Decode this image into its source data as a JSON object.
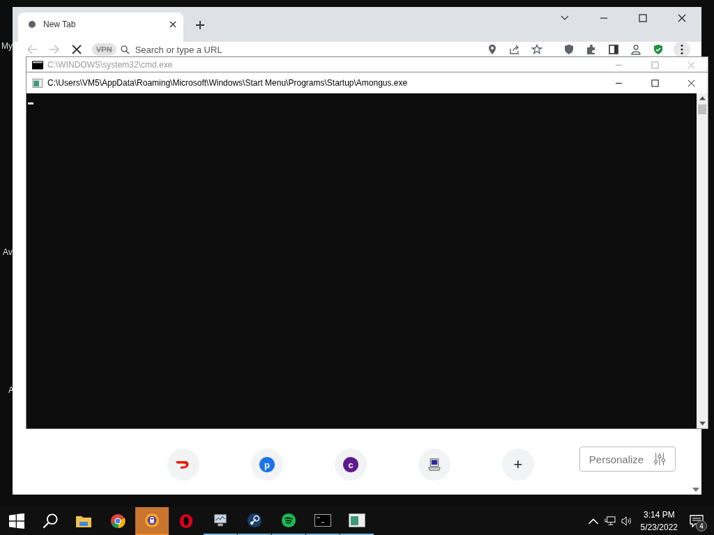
{
  "desktop": {
    "icon_labels": [
      "My",
      "Av",
      "A"
    ]
  },
  "browser": {
    "tabs": [
      {
        "title": "New Tab",
        "selected": true
      }
    ],
    "vpn_label": "VPN",
    "address_bar": {
      "placeholder": "Search or type a URL"
    },
    "shortcuts": [
      {
        "kind": "logo"
      },
      {
        "kind": "letter",
        "letter": "p",
        "color": "#1a73e8"
      },
      {
        "kind": "letter",
        "letter": "c",
        "color": "#5f1a8f"
      },
      {
        "kind": "computer"
      },
      {
        "kind": "add",
        "symbol": "+"
      }
    ],
    "personalize_button": "Personalize"
  },
  "console_windows": [
    {
      "title": "C:\\WINDOWS\\system32\\cmd.exe",
      "active": false
    },
    {
      "title": "C:\\Users\\VM5\\AppData\\Roaming\\Microsoft\\Windows\\Start Menu\\Programs\\Startup\\Amongus.exe",
      "active": true
    }
  ],
  "taskbar": {
    "apps": [
      {
        "kind": "explorer",
        "running": false,
        "selected": false
      },
      {
        "kind": "chrome",
        "running": false,
        "selected": false
      },
      {
        "kind": "brave",
        "running": true,
        "selected": true
      },
      {
        "kind": "opera",
        "running": false,
        "selected": false
      },
      {
        "kind": "monitor",
        "running": true,
        "selected": false
      },
      {
        "kind": "steam",
        "running": true,
        "selected": false
      },
      {
        "kind": "spotify",
        "running": true,
        "selected": false
      },
      {
        "kind": "cmd",
        "running": true,
        "selected": false
      },
      {
        "kind": "app",
        "running": true,
        "selected": false
      }
    ],
    "clock": {
      "time": "3:14 PM",
      "date": "5/23/2022"
    },
    "notifications": {
      "count": "4"
    }
  }
}
